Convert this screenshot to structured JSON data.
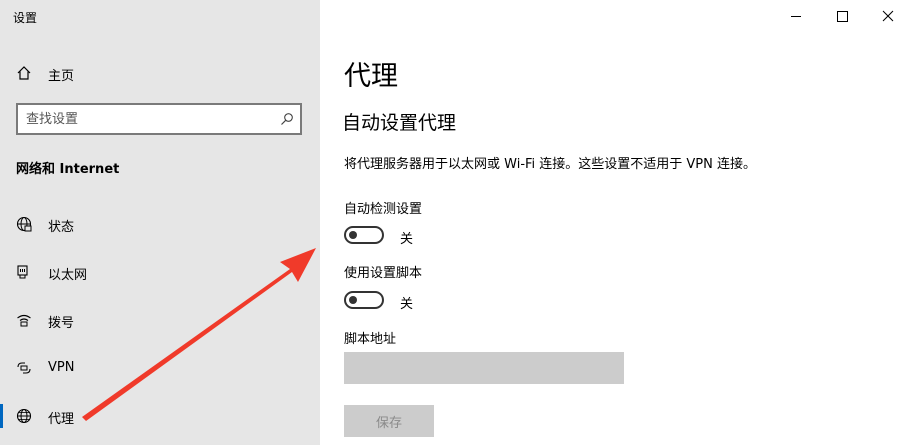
{
  "window": {
    "title": "设置",
    "controls": [
      "minimize-icon",
      "maximize-icon",
      "close-icon"
    ]
  },
  "sidebar": {
    "home_label": "主页",
    "search_placeholder": "查找设置",
    "section_heading": "网络和 Internet",
    "items": [
      {
        "label": "状态",
        "icon": "globe-status-icon"
      },
      {
        "label": "以太网",
        "icon": "ethernet-icon"
      },
      {
        "label": "拨号",
        "icon": "dialup-icon"
      },
      {
        "label": "VPN",
        "icon": "vpn-icon"
      },
      {
        "label": "代理",
        "icon": "globe-icon",
        "active": true
      }
    ]
  },
  "main": {
    "title": "代理",
    "subtitle": "自动设置代理",
    "description": "将代理服务器用于以太网或 Wi-Fi 连接。这些设置不适用于 VPN 连接。",
    "auto_detect": {
      "label": "自动检测设置",
      "state": "关"
    },
    "setup_script": {
      "label": "使用设置脚本",
      "state": "关"
    },
    "script_address": {
      "label": "脚本地址",
      "value": ""
    },
    "save_label": "保存"
  },
  "colors": {
    "sidebar_bg": "#e6e6e6",
    "accent": "#0067c0",
    "annotation_arrow": "#f03a2a",
    "disabled_fill": "#cccccc"
  }
}
